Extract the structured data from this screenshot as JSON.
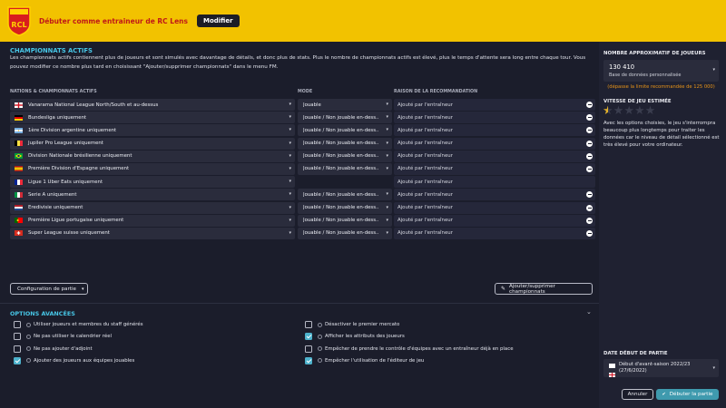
{
  "header": {
    "title": "Débuter comme entraineur de RC Lens",
    "modify_label": "Modifier",
    "accent": "#f2c200"
  },
  "leagues": {
    "title": "CHAMPIONNATS ACTIFS",
    "description": "Les championnats actifs contiennent plus de joueurs et sont simulés avec davantage de détails, et donc plus de stats. Plus le nombre de championnats actifs est élevé, plus le temps d'attente sera long entre chaque tour. Vous pouvez modifier ce nombre plus tard en choisissant \"Ajouter/supprimer championnats\" dans le menu FM.",
    "col_nation": "NATIONS & CHAMPIONNATS ACTIFS",
    "col_mode": "MODE",
    "col_reason": "RAISON DE LA RECOMMANDATION",
    "rows": [
      {
        "flag": "england",
        "name": "Vanarama National League North/South et au-dessus",
        "mode": "Jouable",
        "reason": "Ajouté par l'entraîneur"
      },
      {
        "flag": "germany",
        "name": "Bundesliga uniquement",
        "mode": "Jouable / Non jouable en-dess...",
        "reason": "Ajouté par l'entraîneur"
      },
      {
        "flag": "argentina",
        "name": "1ère Division argentine uniquement",
        "mode": "Jouable / Non jouable en-dess...",
        "reason": "Ajouté par l'entraîneur"
      },
      {
        "flag": "belgium",
        "name": "Jupiler Pro League uniquement",
        "mode": "Jouable / Non jouable en-dess...",
        "reason": "Ajouté par l'entraîneur"
      },
      {
        "flag": "brazil",
        "name": "Division Nationale brésilienne uniquement",
        "mode": "Jouable / Non jouable en-dess...",
        "reason": "Ajouté par l'entraîneur"
      },
      {
        "flag": "spain",
        "name": "Première Division d'Espagne uniquement",
        "mode": "Jouable / Non jouable en-dess...",
        "reason": "Ajouté par l'entraîneur"
      },
      {
        "flag": "france",
        "name": "Ligue 1 Uber Eats uniquement",
        "mode": "",
        "reason": "Ajouté par l'entraîneur"
      },
      {
        "flag": "italy",
        "name": "Serie A uniquement",
        "mode": "Jouable / Non jouable en-dess...",
        "reason": "Ajouté par l'entraîneur"
      },
      {
        "flag": "netherlands",
        "name": "Eredivisie uniquement",
        "mode": "Jouable / Non jouable en-dess...",
        "reason": "Ajouté par l'entraîneur"
      },
      {
        "flag": "portugal",
        "name": "Première Ligue portugaise uniquement",
        "mode": "Jouable / Non jouable en-dess...",
        "reason": "Ajouté par l'entraîneur"
      },
      {
        "flag": "switzerland",
        "name": "Super League suisse uniquement",
        "mode": "Jouable / Non jouable en-dess...",
        "reason": "Ajouté par l'entraîneur"
      }
    ],
    "config_label": "Configuration de partie",
    "add_remove_label": "Ajouter/supprimer championnats"
  },
  "advanced": {
    "title": "OPTIONS AVANCÉES",
    "options_left": [
      {
        "label": "Utiliser joueurs et membres du staff générés",
        "checked": false
      },
      {
        "label": "Ne pas utiliser le calendrier réel",
        "checked": false
      },
      {
        "label": "Ne pas ajouter d'adjoint",
        "checked": false
      },
      {
        "label": "Ajouter des joueurs aux équipes jouables",
        "checked": true
      }
    ],
    "options_right": [
      {
        "label": "Désactiver le premier mercato",
        "checked": false
      },
      {
        "label": "Afficher les attributs des joueurs",
        "checked": true
      },
      {
        "label": "Empêcher de prendre le contrôle d'équipes avec un entraîneur déjà en place",
        "checked": false
      },
      {
        "label": "Empêcher l'utilisation de l'éditeur de jeu",
        "checked": true
      }
    ]
  },
  "right": {
    "players_heading": "NOMBRE APPROXIMATIF DE JOUEURS",
    "players_value": "130 410",
    "players_db": "Base de données personnalisée",
    "players_warning": "(dépasse la limite recommandée de 125 000)",
    "speed_heading": "VITESSE DE JEU ESTIMÉE",
    "speed_rating": 0.5,
    "speed_max": 5,
    "speed_desc": "Avec les options choisies, le jeu s'interrompra beaucoup plus longtemps pour traiter les données car le niveau de détail sélectionné est très élevé pour votre ordinateur.",
    "date_heading": "DATE DÉBUT DE PARTIE",
    "date_value": "Début d'avant-saison 2022/23 (27/6/2022)"
  },
  "footer": {
    "cancel_label": "Annuler",
    "start_label": "Débuter la partie"
  }
}
